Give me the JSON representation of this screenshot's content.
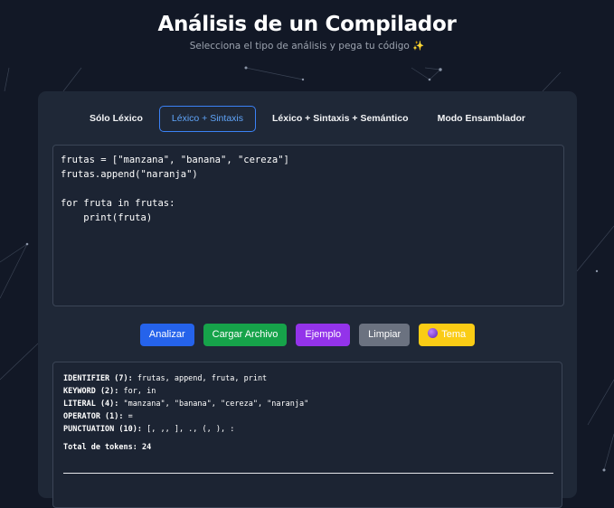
{
  "header": {
    "title": "Análisis de un Compilador",
    "subtitle": "Selecciona el tipo de análisis y pega tu código ✨"
  },
  "tabs": [
    {
      "label": "Sólo Léxico",
      "active": false
    },
    {
      "label": "Léxico + Sintaxis",
      "active": true
    },
    {
      "label": "Léxico + Sintaxis + Semántico",
      "active": false
    },
    {
      "label": "Modo Ensamblador",
      "active": false
    }
  ],
  "editor": {
    "code": "frutas = [\"manzana\", \"banana\", \"cereza\"]\nfrutas.append(\"naranja\")\n\nfor fruta in frutas:\n    print(fruta)"
  },
  "buttons": [
    {
      "label": "Analizar",
      "color": "#2563eb"
    },
    {
      "label": "Cargar Archivo",
      "color": "#16a34a"
    },
    {
      "label": "Ejemplo",
      "color": "#9333ea"
    },
    {
      "label": "Limpiar",
      "color": "#6b7280"
    },
    {
      "label": "Tema",
      "icon": "purple-orb",
      "color": "#facc15"
    }
  ],
  "output": {
    "tokens": [
      {
        "label": "IDENTIFIER (7):",
        "values": "frutas, append, fruta, print"
      },
      {
        "label": "KEYWORD (2):",
        "values": "for, in"
      },
      {
        "label": "LITERAL (4):",
        "values": "\"manzana\", \"banana\", \"cereza\", \"naranja\""
      },
      {
        "label": "OPERATOR (1):",
        "values": "="
      },
      {
        "label": "PUNCTUATION (10):",
        "values": "[, ,, ], ., (, ), :"
      }
    ],
    "total": "Total de tokens: 24"
  }
}
